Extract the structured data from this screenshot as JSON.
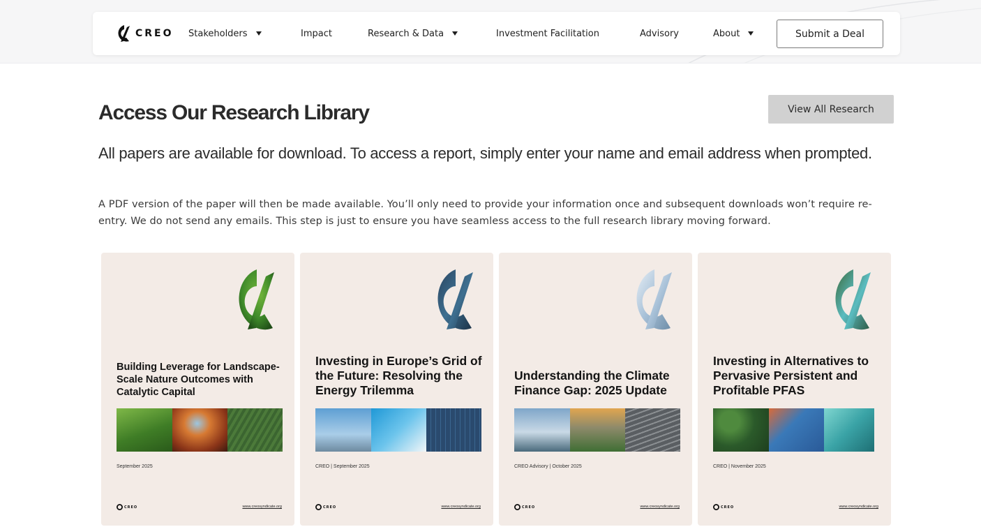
{
  "header": {
    "brand": "CREO",
    "nav": [
      {
        "label": "Stakeholders",
        "has_dropdown": true
      },
      {
        "label": "Impact",
        "has_dropdown": false
      },
      {
        "label": "Research & Data",
        "has_dropdown": true
      },
      {
        "label": "Investment Facilitation",
        "has_dropdown": false
      },
      {
        "label": "Advisory",
        "has_dropdown": false
      },
      {
        "label": "About",
        "has_dropdown": true
      }
    ],
    "cta": "Submit a Deal"
  },
  "main": {
    "title": "Access Our Research Library",
    "view_all": "View All Research",
    "lead": "All papers are available for download. To access a report, simply enter your name and email address when prompted.",
    "body": "A PDF version of the paper will then be made available. You’ll only need to provide your information once and subsequent downloads won’t require re-entry.  We do not send any emails. This step is just to ensure you have seamless access to the full research library moving forward."
  },
  "cards": [
    {
      "title": "Building Leverage for Landscape-Scale Nature Outcomes with Catalytic Capital",
      "meta": "September 2025",
      "footer_brand": "CREO",
      "footer_url": "www.creosyndicate.org",
      "theme_colors": [
        "#2f6b1f",
        "#5c9a2a",
        "#a2461f",
        "#3f6a3a"
      ]
    },
    {
      "title": "Investing in Europe’s Grid of the Future: Resolving the Energy Trilemma",
      "meta": "CREO | September 2025",
      "footer_brand": "CREO",
      "footer_url": "www.creosyndicate.org",
      "theme_colors": [
        "#2c4f6b",
        "#6aa6cf",
        "#1e88c8",
        "#294a6e"
      ]
    },
    {
      "title": "Understanding the Climate Finance Gap: 2025 Update",
      "meta": "CREO Advisory | October 2025",
      "footer_brand": "CREO",
      "footer_url": "www.creosyndicate.org",
      "theme_colors": [
        "#a9c3dc",
        "#5b7a97",
        "#c98d3a",
        "#6b6e70"
      ]
    },
    {
      "title": "Investing in Alternatives to Pervasive Persistent and Profitable PFAS",
      "meta": "CREO | November 2025",
      "footer_brand": "CREO",
      "footer_url": "www.creosyndicate.org",
      "theme_colors": [
        "#3a6b3c",
        "#3d7fb8",
        "#5bbcc0",
        "#2f5e49"
      ]
    }
  ]
}
